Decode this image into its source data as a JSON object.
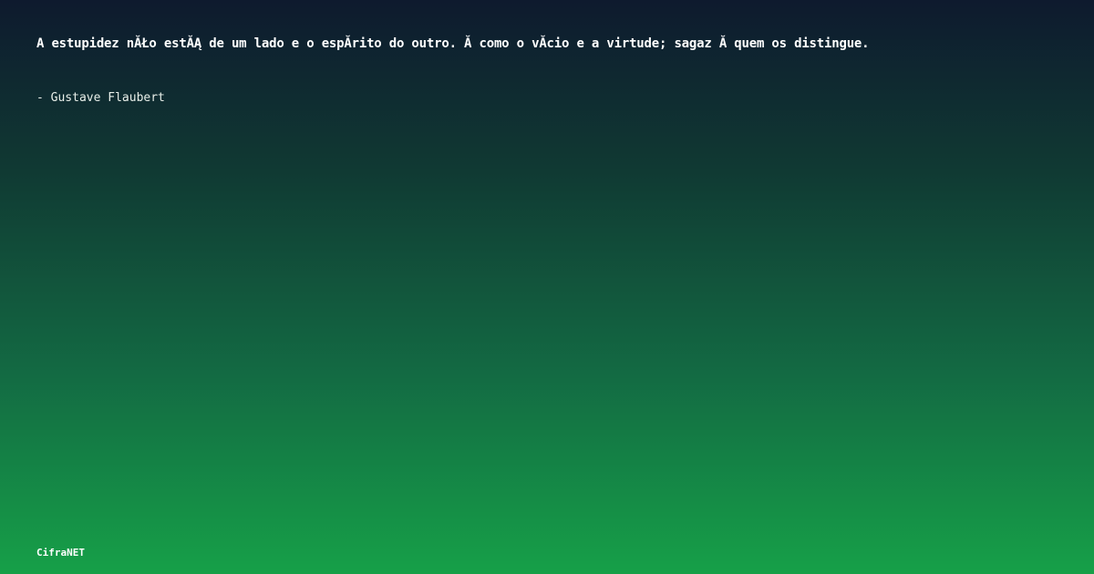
{
  "quote": {
    "text": "A estupidez nĂŁo estĂĄ de um lado e o espĂ­rito do outro. Ă como o vĂ­cio e a virtude; sagaz Ă quem os distingue.",
    "author": "- Gustave Flaubert"
  },
  "brand": {
    "name": "CifraNET"
  },
  "colors": {
    "background_top": "#0e1a2e",
    "background_bottom": "#16a048",
    "text": "#ffffff"
  }
}
